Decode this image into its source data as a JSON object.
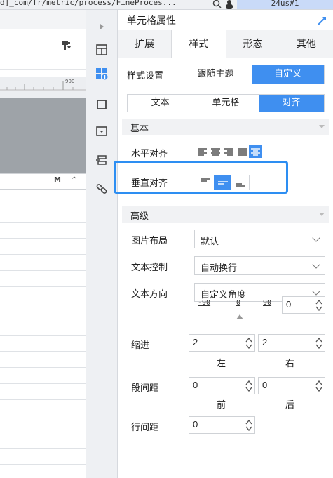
{
  "browser": {
    "url_fragment": "d]_com/fr/metric/process/FineProces...",
    "counter": "24us#1"
  },
  "left": {
    "ruler_label": "900",
    "column_label": "M"
  },
  "panel": {
    "title": "单元格属性",
    "tabs": [
      "扩展",
      "样式",
      "形态",
      "其他"
    ],
    "active_tab": "样式",
    "style_setting_label": "样式设置",
    "style_options": [
      "跟随主题",
      "自定义"
    ],
    "style_selected": "自定义",
    "sub_tabs": [
      "文本",
      "单元格",
      "对齐"
    ],
    "sub_tab_selected": "对齐",
    "section_basic": "基本",
    "horizontal_align_label": "水平对齐",
    "vertical_align_label": "垂直对齐",
    "section_advanced": "高级",
    "image_layout_label": "图片布局",
    "image_layout_value": "默认",
    "text_control_label": "文本控制",
    "text_control_value": "自动换行",
    "text_direction_label": "文本方向",
    "text_direction_value": "自定义角度",
    "slider": {
      "min": "-90",
      "mid": "0",
      "max": "90",
      "value": "0"
    },
    "indent_label": "缩进",
    "indent_left": "2",
    "indent_right": "2",
    "left_caption": "左",
    "right_caption": "右",
    "para_spacing_label": "段间距",
    "para_before": "0",
    "para_after": "0",
    "before_caption": "前",
    "after_caption": "后",
    "line_spacing_label": "行间距",
    "line_spacing": "0"
  },
  "colors": {
    "accent": "#3f8ff0",
    "highlight": "#2d8ef2"
  }
}
